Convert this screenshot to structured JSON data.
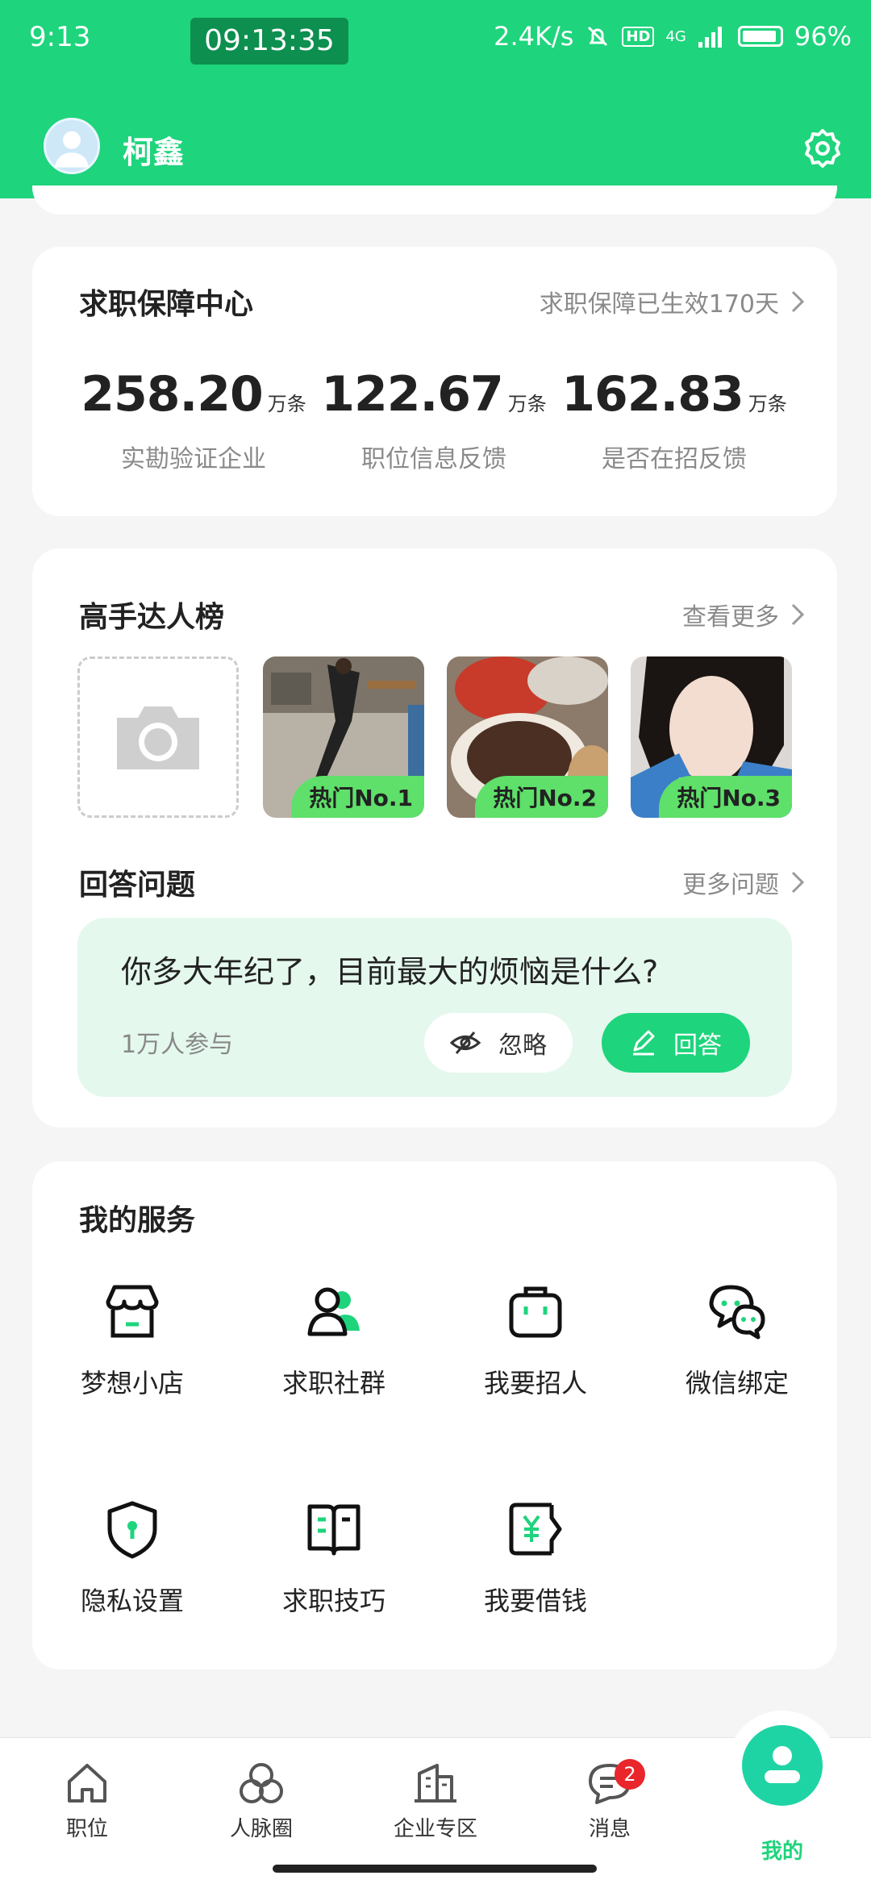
{
  "status_bar": {
    "time": "9:13",
    "clock": "09:13:35",
    "net_speed": "2.4K/s",
    "hd": "HD",
    "network": "4G",
    "battery": "96%"
  },
  "header": {
    "username": "柯鑫",
    "bg_color": "#1ed47c"
  },
  "guarantee": {
    "title": "求职保障中心",
    "status": "求职保障已生效170天",
    "stats": [
      {
        "value": "258.20",
        "unit": "万条",
        "label": "实勘验证企业"
      },
      {
        "value": "122.67",
        "unit": "万条",
        "label": "职位信息反馈"
      },
      {
        "value": "162.83",
        "unit": "万条",
        "label": "是否在招反馈"
      }
    ]
  },
  "experts": {
    "title": "高手达人榜",
    "more": "查看更多",
    "items": [
      {
        "badge": "热门No.1"
      },
      {
        "badge": "热门No.2"
      },
      {
        "badge": "热门No.3"
      }
    ]
  },
  "qa": {
    "title": "回答问题",
    "more": "更多问题",
    "question": "你多大年纪了，目前最大的烦恼是什么?",
    "participants": "1万人参与",
    "ignore_label": "忽略",
    "answer_label": "回答"
  },
  "services": {
    "title": "我的服务",
    "items": [
      {
        "label": "梦想小店",
        "icon": "shop-icon"
      },
      {
        "label": "求职社群",
        "icon": "community-icon"
      },
      {
        "label": "我要招人",
        "icon": "briefcase-icon"
      },
      {
        "label": "微信绑定",
        "icon": "wechat-icon"
      },
      {
        "label": "隐私设置",
        "icon": "shield-icon"
      },
      {
        "label": "求职技巧",
        "icon": "book-icon"
      },
      {
        "label": "我要借钱",
        "icon": "yuan-icon"
      }
    ]
  },
  "tabbar": {
    "tabs": [
      {
        "label": "职位",
        "icon": "home-icon"
      },
      {
        "label": "人脉圈",
        "icon": "circles-icon"
      },
      {
        "label": "企业专区",
        "icon": "building-icon"
      },
      {
        "label": "消息",
        "icon": "message-icon",
        "badge": "2"
      },
      {
        "label": "我的",
        "icon": "user-icon",
        "active": true
      }
    ]
  }
}
